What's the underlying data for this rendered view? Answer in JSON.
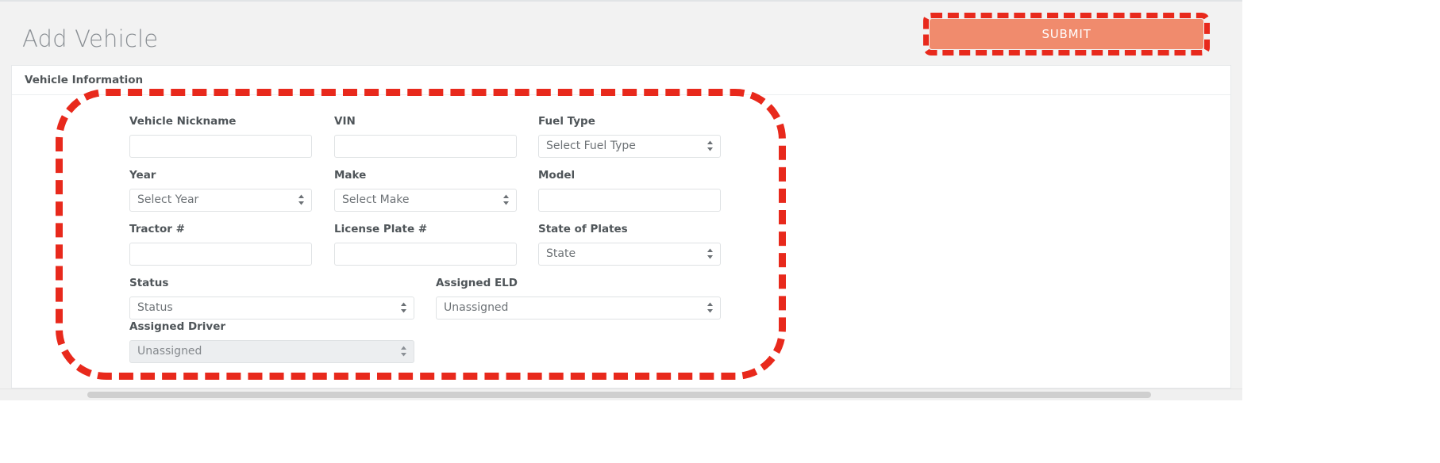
{
  "header": {
    "title": "Add Vehicle",
    "submit_label": "SUBMIT"
  },
  "card": {
    "section_title": "Vehicle Information"
  },
  "form": {
    "rows": [
      {
        "fields": [
          {
            "label": "Vehicle Nickname",
            "type": "text",
            "value": "",
            "placeholder": ""
          },
          {
            "label": "VIN",
            "type": "text",
            "value": "",
            "placeholder": ""
          },
          {
            "label": "Fuel Type",
            "type": "select",
            "value": "Select Fuel Type"
          }
        ]
      },
      {
        "fields": [
          {
            "label": "Year",
            "type": "select",
            "value": "Select Year"
          },
          {
            "label": "Make",
            "type": "select",
            "value": "Select Make"
          },
          {
            "label": "Model",
            "type": "text",
            "value": "",
            "placeholder": ""
          }
        ]
      },
      {
        "fields": [
          {
            "label": "Tractor #",
            "type": "text",
            "value": "",
            "placeholder": ""
          },
          {
            "label": "License Plate #",
            "type": "text",
            "value": "",
            "placeholder": ""
          },
          {
            "label": "State of Plates",
            "type": "select",
            "value": "State"
          }
        ]
      },
      {
        "fields": [
          {
            "label": "Status",
            "type": "select",
            "value": "Status"
          },
          {
            "label": "Assigned ELD",
            "type": "select",
            "value": "Unassigned"
          }
        ]
      },
      {
        "fields": [
          {
            "label": "Assigned Driver",
            "type": "select",
            "value": "Unassigned",
            "disabled": true
          }
        ]
      }
    ]
  },
  "colors": {
    "submit_fill": "#f08b6d",
    "highlight": "#e8291c",
    "page_bg": "#f2f2f2",
    "label_text": "#4f5559",
    "title_text": "#8a8f94"
  },
  "annotations": {
    "submit_highlight": "red-dashed-rounded-rect",
    "form_highlight": "red-dashed-rounded-rect"
  }
}
